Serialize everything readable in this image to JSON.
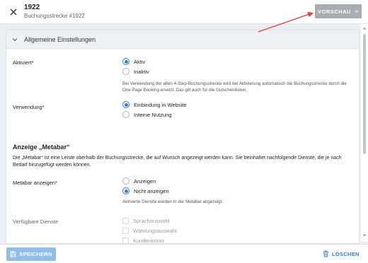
{
  "header": {
    "title": "1922",
    "subtitle": "Buchungsstrecke #1922",
    "preview_label": "VORSCHAU"
  },
  "section": {
    "title": "Allgemeine Einstellungen"
  },
  "activated": {
    "label": "Aktiviert*",
    "options": [
      "Aktiv",
      "Inaktiv"
    ],
    "selected": "Aktiv",
    "help": "Bei Verwendung der alten 4-Step-Buchungsstrecke wird bei Aktivierung automatisch die Buchungsstrecke durch die One Page Booking ersetzt. Das gilt auch für die Gutscheinlisten."
  },
  "usage": {
    "label": "Verwendung*",
    "options": [
      "Einbindung in Website",
      "Interne Nutzung"
    ],
    "selected": "Einbindung in Website"
  },
  "metabar": {
    "heading": "Anzeige „Metabar“",
    "description": "Die „Metabar“ ist eine Leiste oberhalb der Buchungsstrecke, die auf Wunsch angezeigt werden kann. Sie beinhaltet nachfolgende Dienste, die je nach Bedarf hinzugefügt werden können.",
    "show_label": "Metabar anzeigen*",
    "options": [
      "Anzeigen",
      "Nicht anzeigen"
    ],
    "selected": "Nicht anzeigen",
    "help": "Aktivierte Dienste werden in der Metabar angezeigt."
  },
  "services": {
    "label": "Verfügbare Dienste",
    "items": [
      "Sprachauswahl",
      "Währungsauswahl",
      "Kundenkonto"
    ]
  },
  "footer": {
    "save_label": "SPEICHERN",
    "delete_label": "LÖSCHEN"
  },
  "colors": {
    "accent": "#2d7fd3",
    "annotation_arrow": "#e53935",
    "preview_button": "#a9acb0",
    "save_button": "#90bdf0"
  },
  "icons": [
    "close-icon",
    "chevron-down-icon",
    "save-icon",
    "trash-icon"
  ]
}
